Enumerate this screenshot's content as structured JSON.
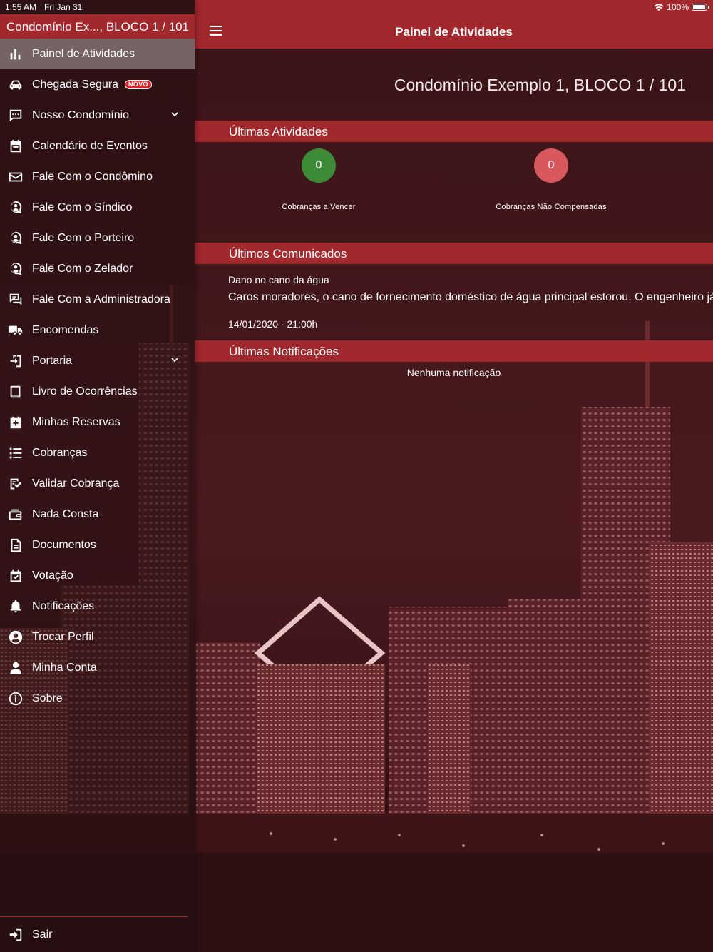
{
  "status_bar": {
    "time": "1:55 AM",
    "date": "Fri Jan 31",
    "battery": "100%",
    "battery_level": 1.0
  },
  "sidebar": {
    "profile": "Condomínio Ex..., BLOCO 1 / 101",
    "items": [
      {
        "label": "Painel de Atividades",
        "icon": "bar-chart-icon",
        "active": true
      },
      {
        "label": "Chegada Segura",
        "icon": "car-icon",
        "badge": "NOVO"
      },
      {
        "label": "Nosso Condomínio",
        "icon": "chat-bubble-icon",
        "expandable": true
      },
      {
        "label": "Calendário de Eventos",
        "icon": "calendar-icon"
      },
      {
        "label": "Fale Com o Condômino",
        "icon": "envelope-icon"
      },
      {
        "label": "Fale Com o Síndico",
        "icon": "person-chat-icon"
      },
      {
        "label": "Fale Com o Porteiro",
        "icon": "person-chat-icon"
      },
      {
        "label": "Fale Com o Zelador",
        "icon": "person-chat-icon"
      },
      {
        "label": "Fale Com a Administradora",
        "icon": "chat-lines-icon"
      },
      {
        "label": "Encomendas",
        "icon": "truck-icon"
      },
      {
        "label": "Portaria",
        "icon": "door-enter-icon",
        "expandable": true
      },
      {
        "label": "Livro de Ocorrências",
        "icon": "book-icon"
      },
      {
        "label": "Minhas Reservas",
        "icon": "calendar-reserve-icon"
      },
      {
        "label": "Cobranças",
        "icon": "list-icon"
      },
      {
        "label": "Validar Cobrança",
        "icon": "validate-icon"
      },
      {
        "label": "Nada Consta",
        "icon": "wallet-icon"
      },
      {
        "label": "Documentos",
        "icon": "document-icon"
      },
      {
        "label": "Votação",
        "icon": "calendar-check-icon"
      },
      {
        "label": "Notificações",
        "icon": "bell-icon"
      },
      {
        "label": "Trocar Perfil",
        "icon": "switch-profile-icon"
      },
      {
        "label": "Minha Conta",
        "icon": "user-icon"
      },
      {
        "label": "Sobre",
        "icon": "info-icon"
      }
    ],
    "logout": "Sair"
  },
  "topbar": {
    "title": "Painel de Atividades"
  },
  "main": {
    "unit_title": "Condomínio Exemplo 1, BLOCO 1 / 101",
    "activities_header": "Últimas Atividades",
    "stats": [
      {
        "value": "0",
        "caption": "Cobranças a Vencer",
        "color": "#3d8b37"
      },
      {
        "value": "0",
        "caption": "Cobranças Não Compensadas",
        "color": "#d8585e"
      }
    ],
    "announcements_header": "Últimos Comunicados",
    "announcement": {
      "title": "Dano no cano da água",
      "body": "Caros moradores, o cano de fornecimento doméstico de água principal estorou. O engenheiro já",
      "date": "14/01/2020 - 21:00h"
    },
    "notifications_header": "Últimas Notificações",
    "notifications_empty": "Nenhuma notificação"
  },
  "colors": {
    "brand": "#a1282d",
    "active_item_bg": "#dcd7d7"
  }
}
